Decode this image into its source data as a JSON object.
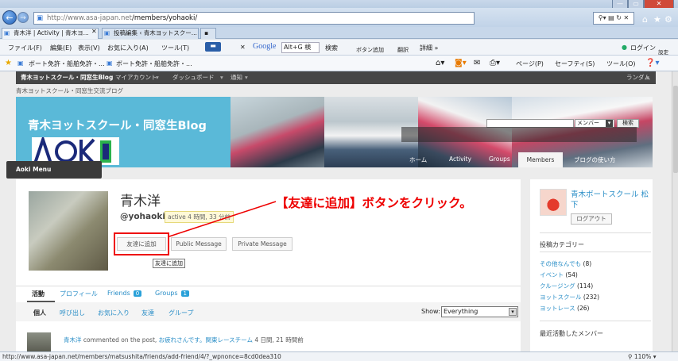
{
  "browser": {
    "address": "http://www.asa-japan.net/members/yohaoki/",
    "address_host": "http://www.asa-japan.net",
    "address_path": "/members/yohaoki/",
    "tabs": [
      {
        "label": "青木洋 | Activity | 青木ヨ..."
      },
      {
        "label": "投稿編集 ‹ 青木ヨットスクー..."
      }
    ],
    "menu": [
      "ファイル(F)",
      "編集(E)",
      "表示(V)",
      "お気に入り(A)",
      "ツール(T)"
    ],
    "search_engine": "Google",
    "search_value": "Alt+G 検",
    "toolbar_items": [
      "検索",
      "ボタン追加",
      "翻訳",
      "詳細 »"
    ],
    "login_label": "ログイン",
    "settings_label": "設定",
    "favorites": [
      "ボート免許・船舶免許・...",
      "ボート免許・船舶免許・..."
    ],
    "right_tools": [
      "ページ(P)",
      "セーフティ(S)",
      "ツール(O)"
    ],
    "status_url": "http://www.asa-japan.net/members/matsushita/friends/add-friend/4/?_wpnonce=8cd0dea310",
    "zoom": "110%"
  },
  "adminbar": {
    "site": "青木ヨットスクール・同窓生Blog",
    "account": "マイアカウント",
    "dashboard": "ダッシュボード",
    "notify": "通知",
    "random": "ランダム"
  },
  "blog": {
    "tagline": "青木ヨットスクール・同窓生交流ブログ",
    "title": "青木ヨットスクール・同窓生Blog",
    "logo_text": "AOKI",
    "search_select": "メンバー",
    "search_button": "検索",
    "nav": [
      "ホーム",
      "Activity",
      "Groups",
      "Members",
      "ブログの使い方"
    ]
  },
  "aoki_menu": "Aoki Menu",
  "profile": {
    "name": "青木洋",
    "handle": "@yohaoki",
    "active": "active 4 時間, 33 分前",
    "buttons": {
      "add_friend": "友達に追加",
      "public_message": "Public Message",
      "private_message": "Private Message"
    },
    "tooltip": "友達に追加",
    "annotation": "【友達に追加】ボタンをクリック。",
    "tabs": [
      {
        "label": "活動"
      },
      {
        "label": "プロフィール"
      },
      {
        "label": "Friends",
        "count": "0"
      },
      {
        "label": "Groups",
        "count": "1"
      }
    ],
    "subnav": [
      "個人",
      "呼び出し",
      "お気に入り",
      "友達",
      "グループ"
    ],
    "show_label": "Show:",
    "show_value": "Everything",
    "feed": {
      "user": "青木洋",
      "text": " commented on the post, ",
      "post": "お疲れさんです。関東レースチーム",
      "time": " 4 日間, 21 時間前"
    }
  },
  "sidebar": {
    "user_name": "青木ボートスクール 松下",
    "logout": "ログアウト",
    "category_heading": "投稿カテゴリー",
    "categories": [
      {
        "name": "その他なんでも",
        "count": "(8)"
      },
      {
        "name": "イベント",
        "count": "(54)"
      },
      {
        "name": "クルージング",
        "count": "(114)"
      },
      {
        "name": "ヨットスクール",
        "count": "(232)"
      },
      {
        "name": "ヨットレース",
        "count": "(26)"
      }
    ],
    "recent_heading": "最近活動したメンバー"
  },
  "colors": {
    "banner": "#5ab9d8",
    "highlight": "#ee0000",
    "link": "#2a8ec7",
    "adminbar": "#464646"
  }
}
